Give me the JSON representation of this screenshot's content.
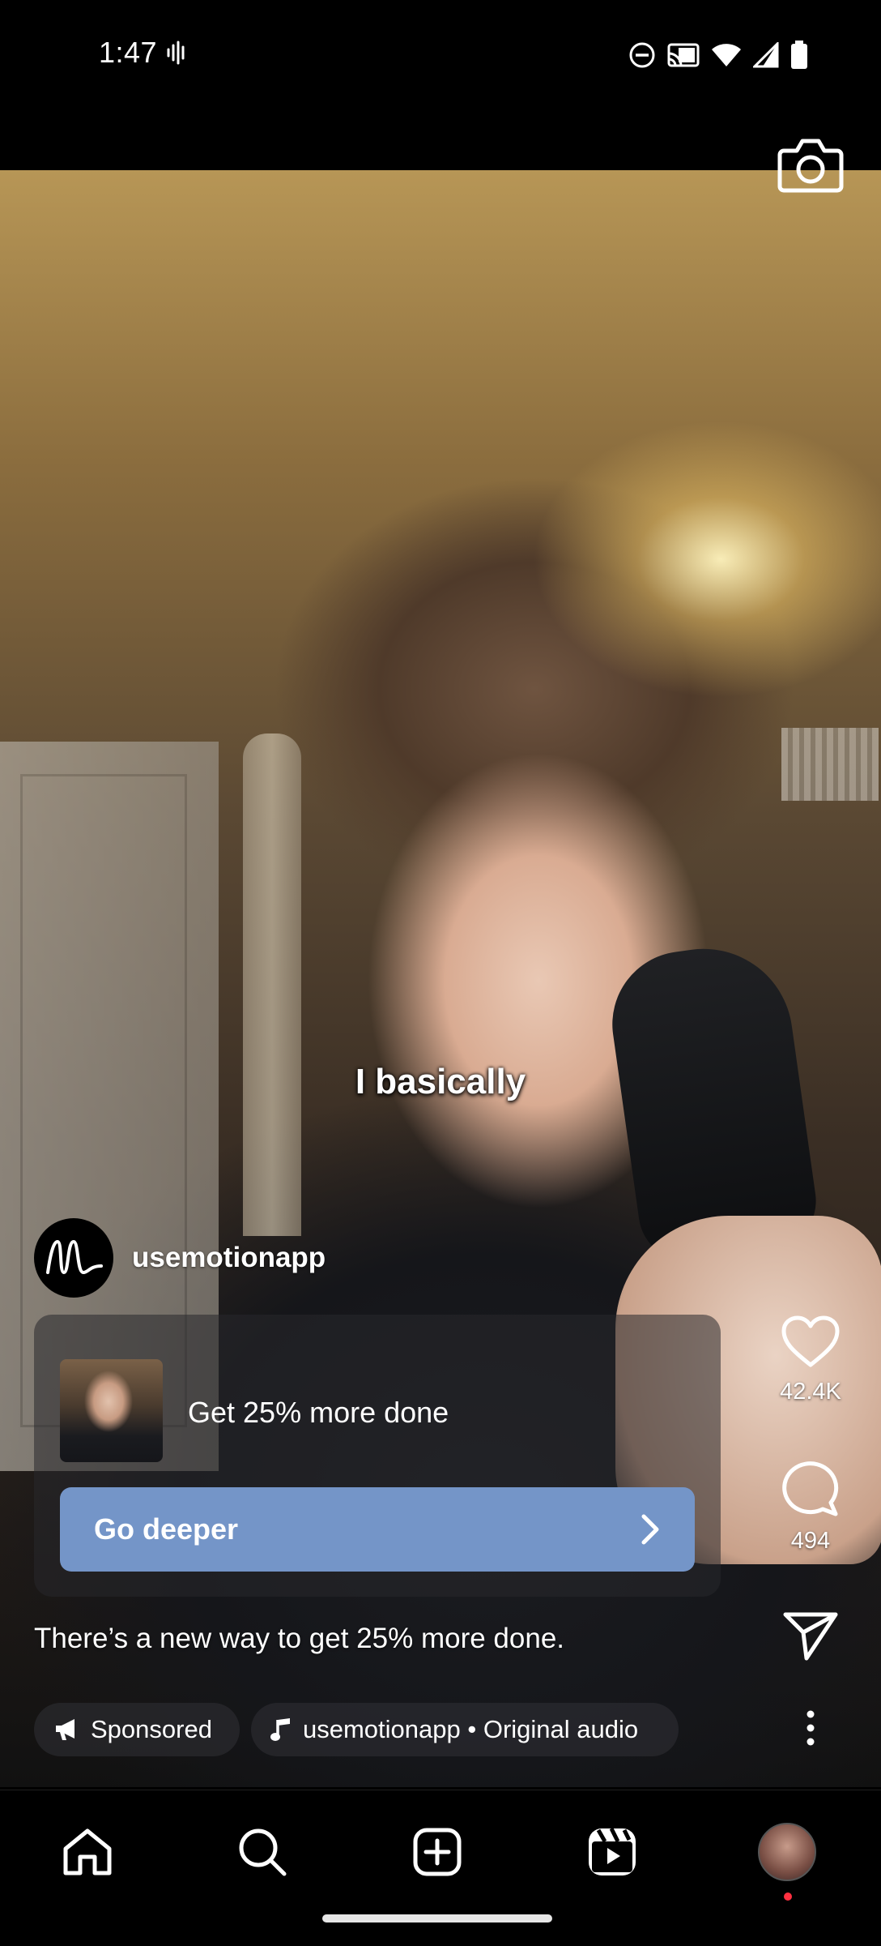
{
  "status_bar": {
    "time": "1:47",
    "icons": [
      "vibrate-icon",
      "do-not-disturb-icon",
      "cast-icon",
      "wifi-icon",
      "signal-icon",
      "battery-icon"
    ]
  },
  "reel": {
    "caption": "I basically",
    "account": {
      "name": "usemotionapp",
      "avatar_letter": "M"
    },
    "ad": {
      "headline": "Get 25% more done",
      "cta_label": "Go deeper"
    },
    "description": "There’s a new way to get 25% more done.",
    "sponsored_label": "Sponsored",
    "audio_label": "usemotionapp • Original audio"
  },
  "actions": {
    "likes": "42.4K",
    "comments": "494"
  },
  "nav": {
    "items": [
      "home-icon",
      "search-icon",
      "create-icon",
      "reels-icon",
      "profile-avatar"
    ]
  },
  "colors": {
    "cta": "#7495c8",
    "notification_dot": "#ff3040"
  }
}
